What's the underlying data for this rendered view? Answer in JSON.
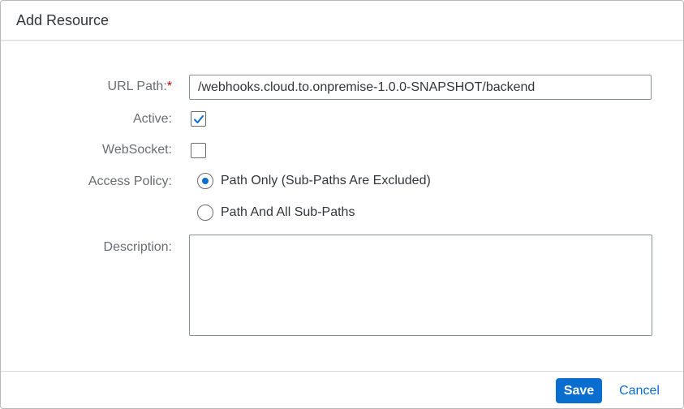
{
  "dialog": {
    "title": "Add Resource"
  },
  "form": {
    "url_path": {
      "label": "URL Path:",
      "required_marker": "*",
      "value": "/webhooks.cloud.to.onpremise-1.0.0-SNAPSHOT/backend"
    },
    "active": {
      "label": "Active:",
      "checked": true
    },
    "websocket": {
      "label": "WebSocket:",
      "checked": false
    },
    "access_policy": {
      "label": "Access Policy:",
      "selected_index": 0,
      "options": [
        {
          "label": "Path Only (Sub-Paths Are Excluded)",
          "selected": true
        },
        {
          "label": "Path And All Sub-Paths",
          "selected": false
        }
      ]
    },
    "description": {
      "label": "Description:",
      "value": ""
    }
  },
  "footer": {
    "save_label": "Save",
    "cancel_label": "Cancel"
  },
  "colors": {
    "accent": "#0a6ed1",
    "required": "#bb0000",
    "label_text": "#6a6d70",
    "body_text": "#32363a"
  },
  "icons": {
    "checkmark": "check-icon"
  }
}
